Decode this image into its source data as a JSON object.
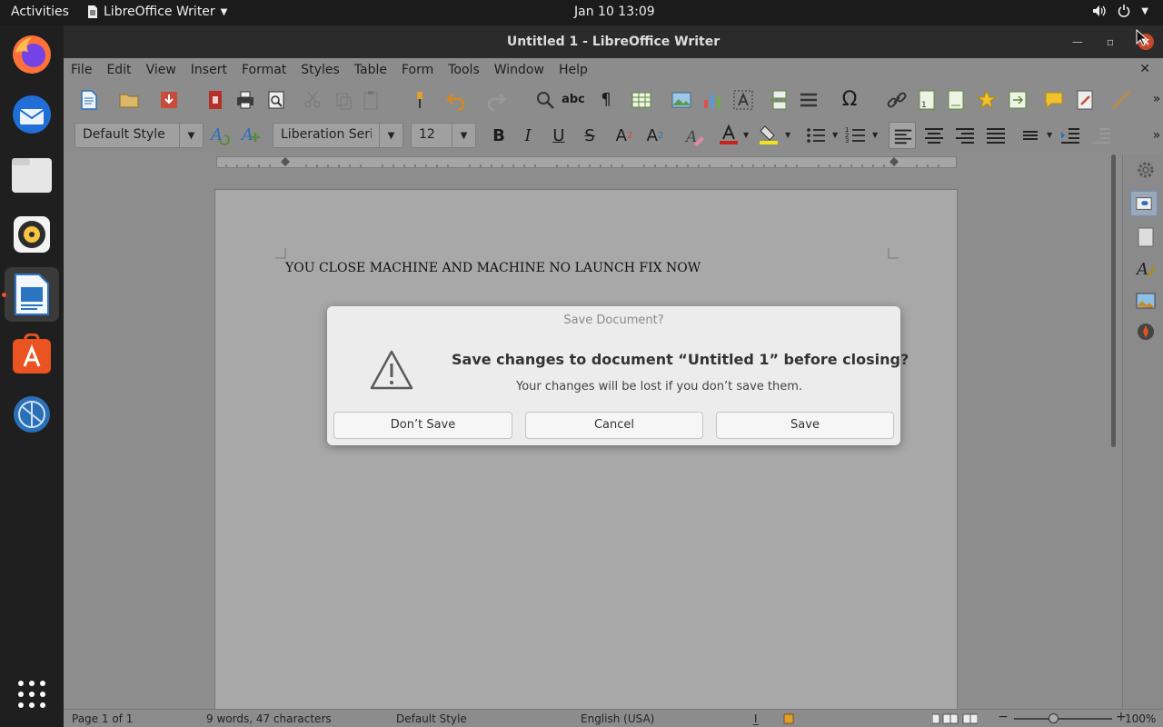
{
  "topbar": {
    "activities": "Activities",
    "app_name": "LibreOffice Writer",
    "clock": "Jan 10  13:09"
  },
  "dock": {
    "apps": [
      "Firefox",
      "Thunderbird",
      "Files",
      "Rhythmbox",
      "LibreOffice Writer",
      "Ubuntu Software",
      "Settings",
      "Show Applications"
    ]
  },
  "window": {
    "title": "Untitled 1 - LibreOffice Writer",
    "menu": [
      "File",
      "Edit",
      "View",
      "Insert",
      "Format",
      "Styles",
      "Table",
      "Form",
      "Tools",
      "Window",
      "Help"
    ]
  },
  "formatting": {
    "paragraph_style": "Default Style",
    "font_name": "Liberation Serif",
    "font_size": "12"
  },
  "document": {
    "text": "YOU CLOSE MACHINE AND MACHINE NO LAUNCH FIX NOW"
  },
  "dialog": {
    "title": "Save Document?",
    "heading": "Save changes to document “Untitled 1” before closing?",
    "message": "Your changes will be lost if you don’t save them.",
    "buttons": {
      "dont_save": "Don’t Save",
      "cancel": "Cancel",
      "save": "Save"
    }
  },
  "statusbar": {
    "page": "Page 1 of 1",
    "words": "9 words, 47 characters",
    "style": "Default Style",
    "language": "English (USA)",
    "zoom": "100%"
  },
  "colors": {
    "accent": "#e95420",
    "topbar": "#1b1b1b",
    "dialog_bg": "#ececec"
  }
}
